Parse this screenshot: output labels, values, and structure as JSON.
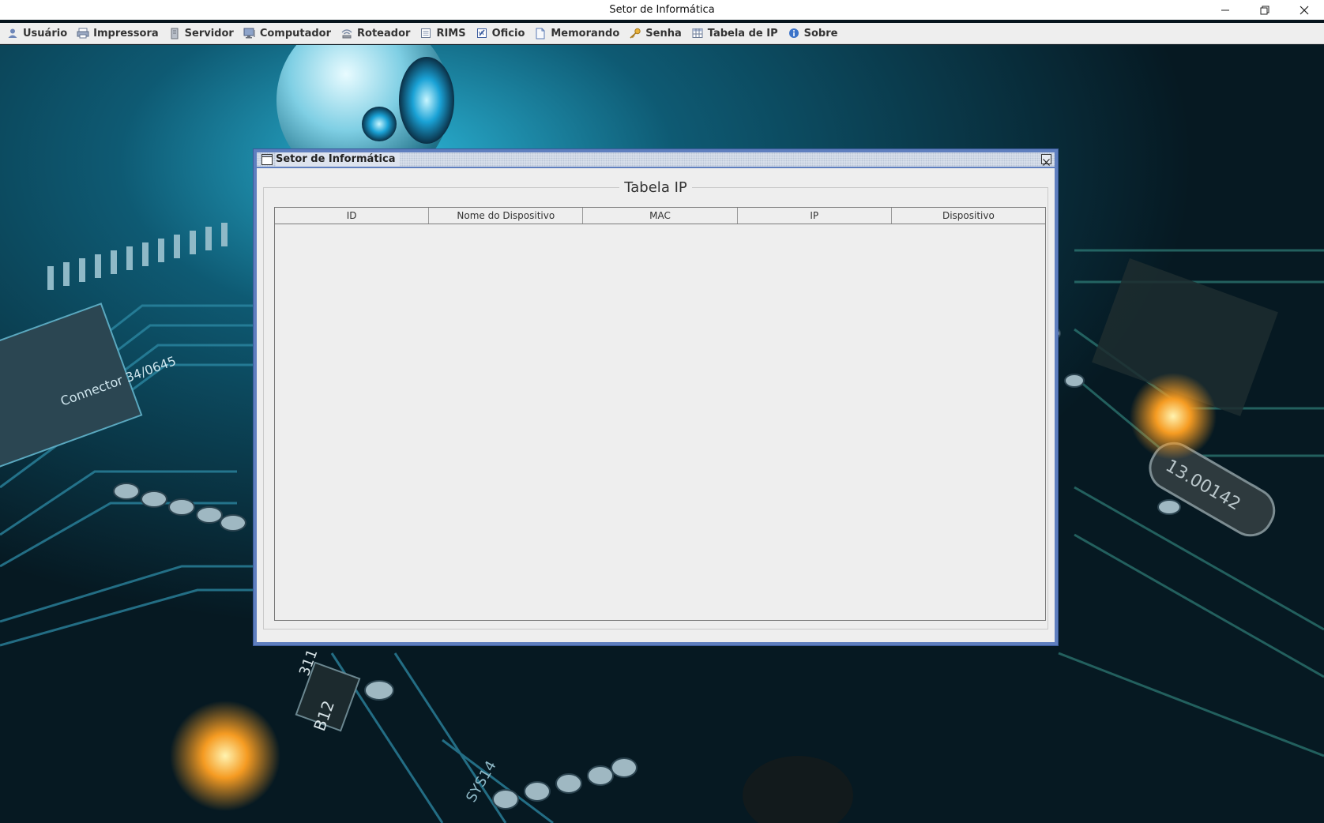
{
  "window": {
    "title": "Setor de Informática"
  },
  "menubar": {
    "items": [
      {
        "label": "Usuário",
        "icon": "user-icon"
      },
      {
        "label": "Impressora",
        "icon": "printer-icon"
      },
      {
        "label": "Servidor",
        "icon": "server-icon"
      },
      {
        "label": "Computador",
        "icon": "computer-icon"
      },
      {
        "label": "Roteador",
        "icon": "router-icon"
      },
      {
        "label": "RIMS",
        "icon": "document-icon"
      },
      {
        "label": "Oficio",
        "icon": "edit-document-icon"
      },
      {
        "label": "Memorando",
        "icon": "memo-icon"
      },
      {
        "label": "Senha",
        "icon": "key-icon"
      },
      {
        "label": "Tabela de IP",
        "icon": "table-icon"
      },
      {
        "label": "Sobre",
        "icon": "info-icon"
      }
    ]
  },
  "internal_frame": {
    "title": "Setor de Informática",
    "panel_title": "Tabela IP",
    "table": {
      "columns": [
        "ID",
        "Nome do Dispositivo",
        "MAC",
        "IP",
        "Dispositivo"
      ],
      "rows": []
    }
  },
  "desktop": {
    "wallpaper_text": {
      "chip_label": "13.00142",
      "connector_label": "Connector 34/0645",
      "board_label_1": "B12",
      "board_label_2": "311",
      "board_label_3": "SYS14"
    }
  },
  "colors": {
    "frame_border": "#5f7fbf",
    "panel_bg": "#eeeeee",
    "menubar_bg": "#eeeeee"
  }
}
